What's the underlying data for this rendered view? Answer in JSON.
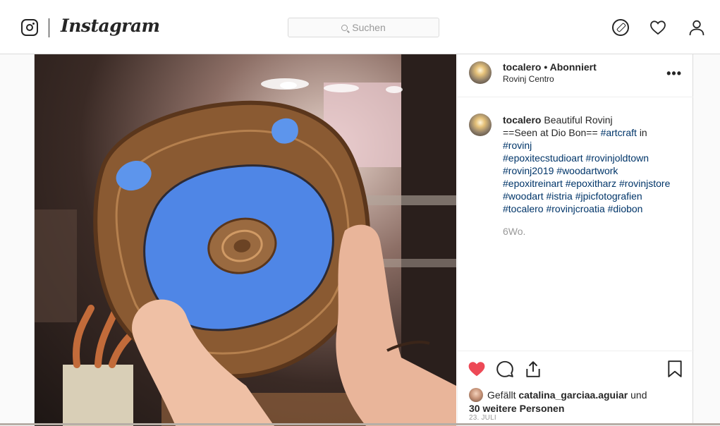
{
  "topbar": {
    "brand": "Instagram",
    "search_placeholder": "Suchen"
  },
  "post": {
    "username": "tocalero",
    "follow_status": "Abonniert",
    "location": "Rovinj Centro",
    "more_label": "•••",
    "caption": {
      "username": "tocalero",
      "text_1": "Beautiful Rovinj",
      "text_2": "==Seen at Dio Bon==",
      "tag_artcraft": "#artcraft",
      "text_in": "in",
      "tag_rovinj": "#rovinj",
      "tag_epoxitecstudioart": "#epoxitecstudioart",
      "tag_rovinjoldtown": "#rovinjoldtown",
      "tag_rovinj2019": "#rovinj2019",
      "tag_woodartwork": "#woodartwork",
      "tag_epoxitreinart": "#epoxitreinart",
      "tag_epoxitharz": "#epoxitharz",
      "tag_rovinjstore": "#rovinjstore",
      "tag_woodart": "#woodart",
      "tag_istria": "#istria",
      "tag_jpicfotografien": "#jpicfotografien",
      "tag_tocalero": "#tocalero",
      "tag_rovinjcroatia": "#rovinjcroatia",
      "tag_diobon": "#diobon"
    },
    "time_ago": "6Wo.",
    "likes": {
      "prefix": "Gefällt",
      "liker": "catalina_garciaa.aguiar",
      "conj": "und",
      "others": "30 weitere Personen"
    },
    "date": "23. JULI"
  },
  "colors": {
    "like_red": "#ed4956",
    "link_blue": "#003569",
    "epoxy_blue": "#4f86e6",
    "wood_brown": "#8a5a32"
  }
}
